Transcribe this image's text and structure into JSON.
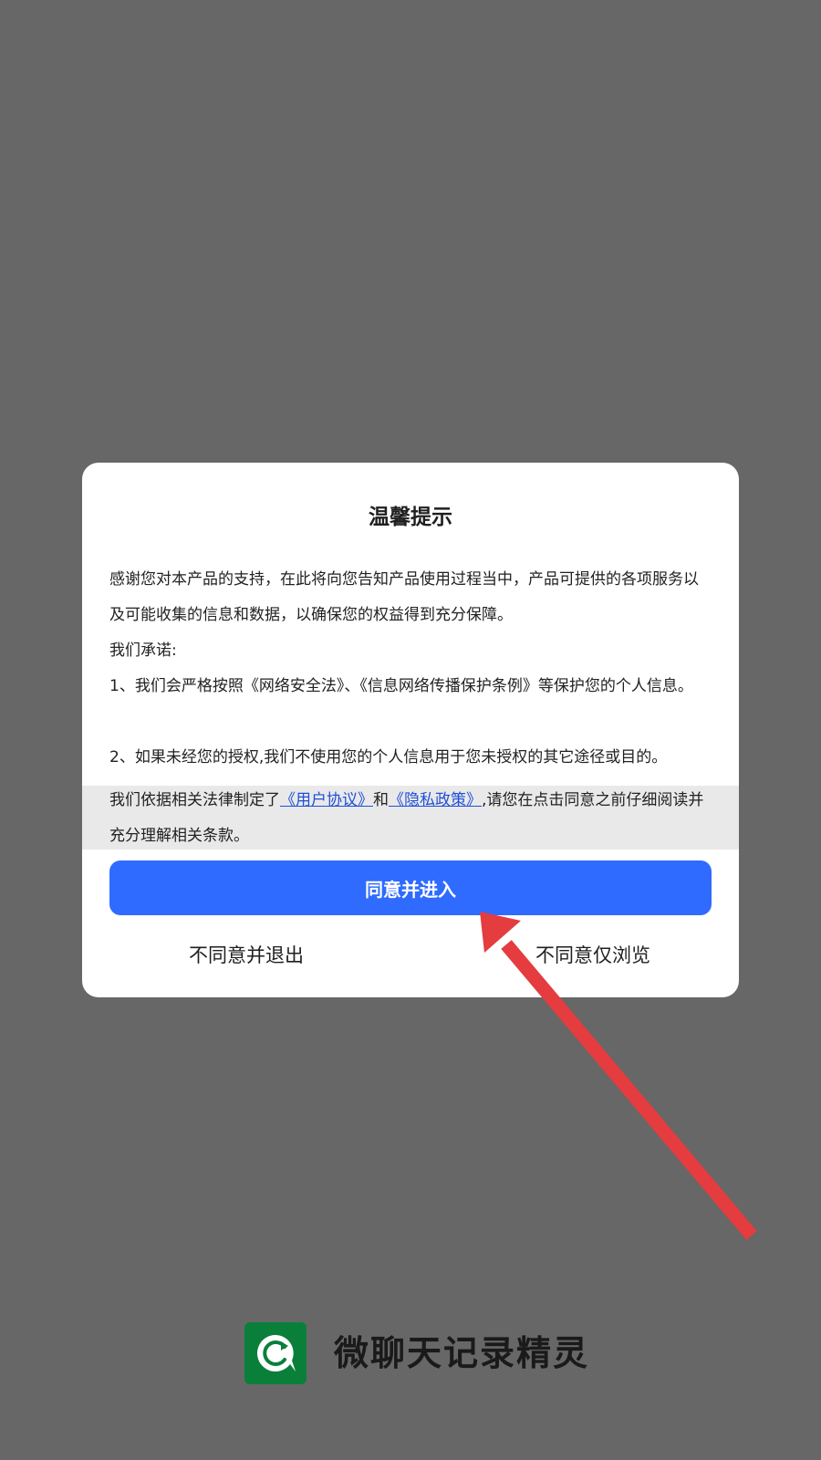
{
  "dialog": {
    "title": "温馨提示",
    "intro": "感谢您对本产品的支持，在此将向您告知产品使用过程当中，产品可提供的各项服务以及可能收集的信息和数据，以确保您的权益得到充分保障。",
    "promise_heading": "我们承诺:",
    "items": [
      "1、我们会严格按照《网络安全法》、《信息网络传播保护条例》等保护您的个人信息。",
      "2、如果未经您的授权,我们不使用您的个人信息用于您未授权的其它途径或目的。"
    ],
    "legal": {
      "prefix": "我们依据相关法律制定了",
      "user_agreement_link": "《用户协议》",
      "and": "和",
      "privacy_policy_link": "《隐私政策》",
      "suffix": ",请您在点击同意之前仔细阅读并充分理解相关条款。"
    },
    "buttons": {
      "agree": "同意并进入",
      "disagree_exit": "不同意并退出",
      "disagree_browse": "不同意仅浏览"
    }
  },
  "brand": {
    "app_name": "微聊天记录精灵",
    "logo_icon": "chat-refresh-icon",
    "logo_color": "#0a7f3a"
  },
  "colors": {
    "overlay": "#676767",
    "primary": "#2f6bfe",
    "link": "#1f4fd8",
    "annotation_arrow": "#e43c3f"
  }
}
